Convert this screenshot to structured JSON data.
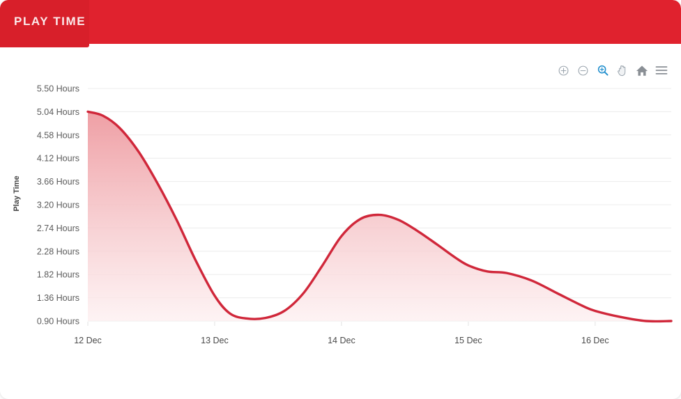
{
  "header": {
    "title": "PLAY TIME",
    "bar_color": "#e0222e",
    "tab_color": "#d81f2a",
    "title_color": "#fbe9ea"
  },
  "toolbar": {
    "items": [
      {
        "name": "zoom-in-icon",
        "label": "Zoom In",
        "active": false,
        "color": "#9aa4ad"
      },
      {
        "name": "zoom-out-icon",
        "label": "Zoom Out",
        "active": false,
        "color": "#9aa4ad"
      },
      {
        "name": "selection-zoom-icon",
        "label": "Selection Zoom",
        "active": true,
        "color": "#1f8ecd"
      },
      {
        "name": "panning-icon",
        "label": "Panning",
        "active": false,
        "color": "#9aa4ad"
      },
      {
        "name": "home-icon",
        "label": "Reset Zoom",
        "active": false,
        "color": "#8a8f95"
      },
      {
        "name": "menu-icon",
        "label": "Menu",
        "active": false,
        "color": "#8a8f95"
      }
    ]
  },
  "chart_data": {
    "type": "area",
    "title": "PLAY TIME",
    "xlabel": "",
    "ylabel": "Play Time",
    "categories": [
      "12 Dec",
      "13 Dec",
      "14 Dec",
      "15 Dec",
      "16 Dec"
    ],
    "x_tick_labels": [
      "12 Dec",
      "13 Dec",
      "14 Dec",
      "15 Dec",
      "16 Dec"
    ],
    "y_tick_labels": [
      "5.50 Hours",
      "5.04 Hours",
      "4.58 Hours",
      "4.12 Hours",
      "3.66 Hours",
      "3.20 Hours",
      "2.74 Hours",
      "2.28 Hours",
      "1.82 Hours",
      "1.36 Hours",
      "0.90 Hours"
    ],
    "y_tick_values": [
      5.5,
      5.04,
      4.58,
      4.12,
      3.66,
      3.2,
      2.74,
      2.28,
      1.82,
      1.36,
      0.9
    ],
    "ylim": [
      0.9,
      5.5
    ],
    "y_unit": "Hours",
    "grid": true,
    "legend": false,
    "series": [
      {
        "name": "Play Time",
        "line_color": "#d0273a",
        "fill_top_color": "#ee9aa0",
        "fill_bottom_color": "#fdeff0",
        "x": [
          0,
          0.12,
          0.25,
          0.4,
          0.55,
          0.7,
          0.85,
          1.0,
          1.12,
          1.25,
          1.4,
          1.55,
          1.7,
          1.85,
          2.0,
          2.15,
          2.3,
          2.45,
          2.6,
          2.75,
          2.9,
          3.0,
          3.15,
          3.3,
          3.5,
          3.7,
          3.9,
          4.0,
          4.2,
          4.4,
          4.6
        ],
        "values": [
          5.04,
          4.96,
          4.72,
          4.25,
          3.62,
          2.9,
          2.1,
          1.4,
          1.05,
          0.95,
          0.96,
          1.1,
          1.45,
          2.0,
          2.58,
          2.92,
          3.0,
          2.9,
          2.68,
          2.42,
          2.15,
          2.0,
          1.88,
          1.85,
          1.7,
          1.45,
          1.2,
          1.1,
          0.98,
          0.9,
          0.9
        ]
      }
    ]
  }
}
